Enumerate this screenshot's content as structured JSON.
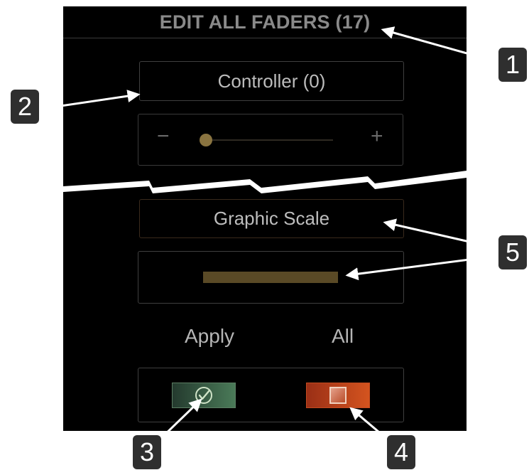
{
  "header": {
    "title": "EDIT ALL FADERS (17)"
  },
  "controller": {
    "label": "Controller (0)",
    "minus": "−",
    "plus": "+",
    "value": 0
  },
  "graphic_scale": {
    "label": "Graphic Scale"
  },
  "apply": {
    "apply_label": "Apply",
    "all_label": "All"
  },
  "callouts": [
    "1",
    "2",
    "3",
    "4",
    "5"
  ],
  "colors": {
    "accent_gold": "#8a7440",
    "ok_green": "#4a7a58",
    "stop_orange": "#d4541f"
  },
  "icons": {
    "ok": "check-circle-icon",
    "stop": "stop-square-icon"
  }
}
